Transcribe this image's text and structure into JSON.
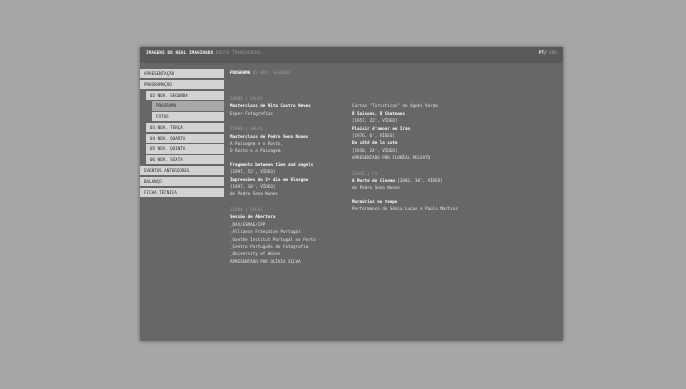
{
  "header": {
    "site_title_main": "IMAGENS DO REAL IMAGINADO",
    "site_title_sub": "DOUTO TRANSVERSAL",
    "lang_active": "PT",
    "lang_separator": "/",
    "lang_inactive": "ENG"
  },
  "nav": {
    "items": [
      {
        "label": "APRESENTAÇÃO",
        "level": 0,
        "active": false
      },
      {
        "label": "PROGRAMAÇÃO",
        "level": 0,
        "active": false
      },
      {
        "label": "02 NOV. SEGUNDA",
        "level": 1,
        "active": false
      },
      {
        "label": "PROGRAMA",
        "level": 2,
        "active": true
      },
      {
        "label": "FOTOS",
        "level": 2,
        "active": false
      },
      {
        "label": "03 NOV. TERÇA",
        "level": 1,
        "active": false
      },
      {
        "label": "04 NOV. QUARTA",
        "level": 1,
        "active": false
      },
      {
        "label": "05 NOV. QUINTA",
        "level": 1,
        "active": false
      },
      {
        "label": "06 NOV. SEXTA",
        "level": 1,
        "active": false
      },
      {
        "label": "EVENTOS ANTERIORES",
        "level": 0,
        "active": false
      },
      {
        "label": "BALANÇO",
        "level": 0,
        "active": false
      },
      {
        "label": "FICHA TÉCNICA",
        "level": 0,
        "active": false
      }
    ]
  },
  "page": {
    "heading": "PROGRAMA",
    "subheading": "02 NOV. SEGUNDA"
  },
  "col1": {
    "b1_time": "10H00 | SALA1",
    "b1_title": "Masterclass de Rita Castro Neves",
    "b1_line1": "Esper Fotografias",
    "b2_time": "15H00 | SALA1",
    "b2_title": "Masterclass de Pedro Sena Nunes",
    "b2_line1": "A Paisagem e o Rosto,",
    "b2_line2": "O Rosto e a Paisagem",
    "b3_title": "Fragments between time and angels",
    "b3_line1": "[1997, 52', VÍDEO]",
    "b3_title2": "Impressões do 3º dia em Glasgow",
    "b3_line2": "[1997, 10', VÍDEO]",
    "b3_line3": "de Pedro Sena Nunes",
    "b4_time": "21H00 | SALA1",
    "b4_title": "Sessão de Abertura",
    "b4_line1": "_DAV/ESMAE/IPP",
    "b4_line2": "_Alliance Française Portugal",
    "b4_line3": "_Goethe Institut Portugal no Porto",
    "b4_line4": "_Centro Português de Fotografia",
    "b4_line5": "_University of Wales",
    "b4_line6": "APRESENTADO POR OLÍVIA SILVA"
  },
  "col2": {
    "c1_line0": "Curtas \"Turísticas\" de Agnès Varda",
    "c1_title1": "Ô Saisons, Ô Chateaux",
    "c1_line1": "[1957, 22', VÍDEO]",
    "c1_title2": "Plaisir d'amour en Iran",
    "c1_line2": "[1976, 6', VÍDEO]",
    "c1_title3": "Du côté de la cote",
    "c1_line3": "[1958, 24', VÍDEO]",
    "c1_line4": "APRESENTADO POR FLORÊAL PELEATO",
    "c2_time": "22H30 | P3",
    "c2_title": "A Morte do Cinema",
    "c2_title_suffix": "[2002, 30', VÍDEO]",
    "c2_line1": "de Pedro Sena Nunes",
    "c3_title": "Murmúrios no tempo",
    "c3_line1": "Performance de Sónia Lucas e Paulo Martins"
  }
}
